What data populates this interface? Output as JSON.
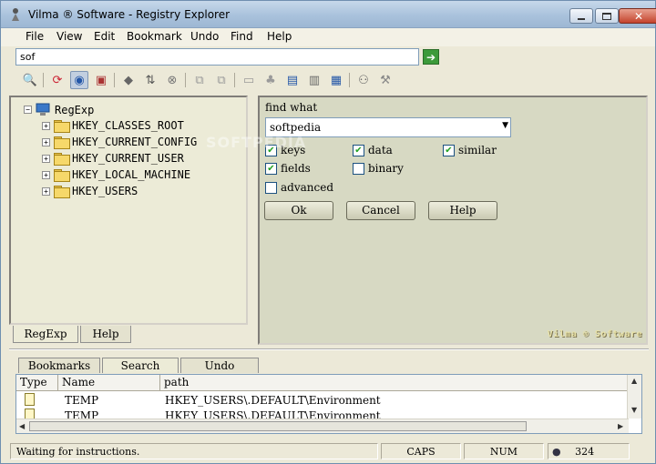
{
  "window": {
    "title": "Vilma ® Software - Registry Explorer"
  },
  "menu": [
    "File",
    "View",
    "Edit",
    "Bookmark",
    "Undo",
    "Find",
    "Help"
  ],
  "address": {
    "value": "sof"
  },
  "tree": {
    "root": "RegExp",
    "keys": [
      "HKEY_CLASSES_ROOT",
      "HKEY_CURRENT_CONFIG",
      "HKEY_CURRENT_USER",
      "HKEY_LOCAL_MACHINE",
      "HKEY_USERS"
    ]
  },
  "left_tabs": [
    "RegExp",
    "Help"
  ],
  "find": {
    "label": "find what",
    "value": "softpedia",
    "options": {
      "keys": {
        "label": "keys",
        "checked": true
      },
      "data": {
        "label": "data",
        "checked": true
      },
      "similar": {
        "label": "similar",
        "checked": true
      },
      "fields": {
        "label": "fields",
        "checked": true
      },
      "binary": {
        "label": "binary",
        "checked": false
      },
      "advanced": {
        "label": "advanced",
        "checked": false
      }
    },
    "buttons": {
      "ok": "Ok",
      "cancel": "Cancel",
      "help": "Help"
    },
    "brand": "Vilma ® Software",
    "watermark": "SOFTPEDIA"
  },
  "bottom_tabs": [
    "Bookmarks",
    "Search",
    "Undo"
  ],
  "results": {
    "columns": [
      "Type",
      "Name",
      "path"
    ],
    "rows": [
      {
        "name": "TEMP",
        "path": "HKEY_USERS\\.DEFAULT\\Environment"
      },
      {
        "name": "TEMP",
        "path": "HKEY_USERS\\.DEFAULT\\Environment"
      }
    ]
  },
  "status": {
    "message": "Waiting for instructions.",
    "caps": "CAPS",
    "num": "NUM",
    "count": "324"
  },
  "colors": {
    "accent_green": "#3c9a3a",
    "check": "#21a121",
    "panel": "#d7d9c3"
  }
}
